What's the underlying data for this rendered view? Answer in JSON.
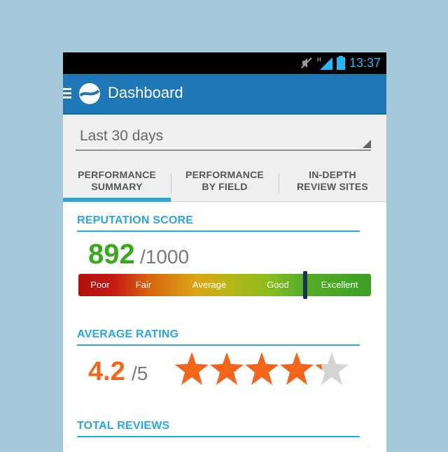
{
  "status_bar": {
    "time": "13:37",
    "icons": [
      "mute-icon",
      "h-signal-icon",
      "battery-icon"
    ]
  },
  "app_bar": {
    "title": "Dashboard",
    "menu_icon": "menu-icon",
    "logo_icon": "app-logo-icon",
    "color": "#1f78b5"
  },
  "filter": {
    "selected": "Last 30 days"
  },
  "tabs": [
    {
      "label": "PERFORMANCE\nSUMMARY",
      "active": true
    },
    {
      "label": "PERFORMANCE\nBY FIELD",
      "active": false
    },
    {
      "label": "IN-DEPTH\nREVIEW SITES",
      "active": false
    }
  ],
  "reputation": {
    "title": "REPUTATION SCORE",
    "score": "892",
    "max": "/1000",
    "segments": [
      "Poor",
      "Fair",
      "Average",
      "Good",
      "Excellent"
    ],
    "marker_fraction": 0.776
  },
  "rating": {
    "title": "AVERAGE RATING",
    "value": "4.2",
    "max": "/5",
    "stars_filled": 4.2,
    "stars_total": 5,
    "star_color": "#f2651a"
  },
  "total_reviews": {
    "title": "TOTAL REVIEWS"
  }
}
